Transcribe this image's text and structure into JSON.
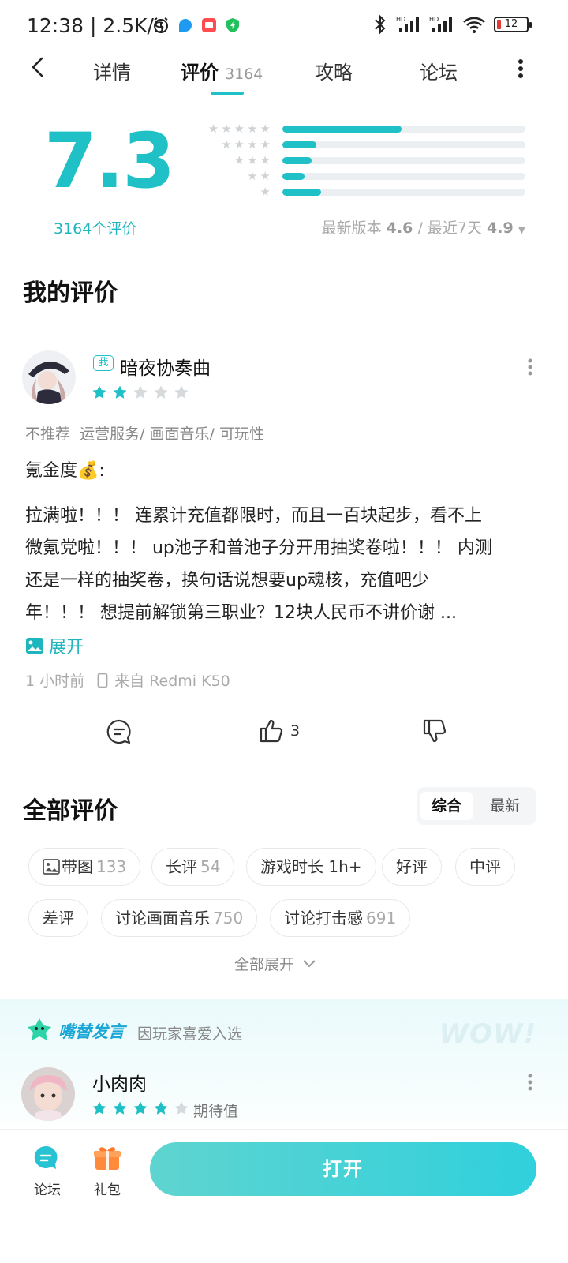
{
  "status_bar": {
    "time": "12:38 | 2.5K/s",
    "battery": "12"
  },
  "nav": {
    "tabs": [
      {
        "label": "详情"
      },
      {
        "label": "评价",
        "count": "3164"
      },
      {
        "label": "攻略"
      },
      {
        "label": "论坛"
      }
    ]
  },
  "rating": {
    "score": "7.3",
    "count_label": "3164个评价",
    "distribution": [
      {
        "stars": 5,
        "fraction": 0.49
      },
      {
        "stars": 4,
        "fraction": 0.14
      },
      {
        "stars": 3,
        "fraction": 0.12
      },
      {
        "stars": 2,
        "fraction": 0.09
      },
      {
        "stars": 1,
        "fraction": 0.16
      }
    ],
    "version_label": "最新版本",
    "version_score": "4.6",
    "separator": "/",
    "recent_label": "最近7天",
    "recent_score": "4.9"
  },
  "my_review": {
    "heading": "我的评价",
    "me_badge": "我",
    "username": "暗夜协奏曲",
    "stars": 2,
    "tags": "不推荐  运营服务/ 画面音乐/ 可玩性",
    "lines": [
      "氪金度💰:",
      "拉满啦！！！ 连累计充值都限时，而且一百块起步，看不上",
      "微氪党啦！！！ up池子和普池子分开用抽奖卷啦！！！ 内测",
      "还是一样的抽奖卷，换句话说想要up魂核，充值吧少",
      "年！！！ 想提前解锁第三职业？12块人民币不讲价谢 ..."
    ],
    "expand_label": "展开",
    "time": "1 小时前",
    "device": "来自 Redmi K50",
    "likes": "3"
  },
  "all_reviews": {
    "heading": "全部评价",
    "sort_options": [
      "综合",
      "最新"
    ],
    "chips": [
      {
        "label": "带图",
        "count": "133"
      },
      {
        "label": "长评",
        "count": "54"
      },
      {
        "label": "游戏时长 1h+",
        "count": ""
      },
      {
        "label": "好评",
        "count": ""
      },
      {
        "label": "中评",
        "count": ""
      },
      {
        "label": "差评",
        "count": ""
      },
      {
        "label": "讨论画面音乐",
        "count": "750"
      },
      {
        "label": "讨论打击感",
        "count": "691"
      }
    ],
    "expand_all": "全部展开"
  },
  "featured": {
    "logo_text": "嘴替发言",
    "subtitle": "因玩家喜爱入选",
    "wow": "WOW!",
    "username": "小肉肉",
    "stars": 4,
    "stars_label": "期待值"
  },
  "bottom_bar": {
    "forum_label": "论坛",
    "gift_label": "礼包",
    "open_label": "打开"
  },
  "colors": {
    "accent": "#1fc1c7",
    "star_empty": "#d6dadc"
  }
}
